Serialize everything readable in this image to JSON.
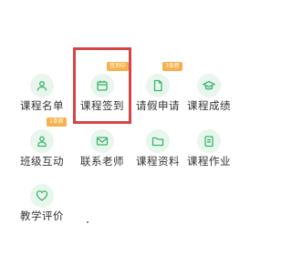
{
  "accent_color": "#3bb56b",
  "badge_color": "#f6b14c",
  "highlight_color": "#d64545",
  "tiles": [
    {
      "label": "课程名单",
      "icon": "person-list-icon",
      "badge": ""
    },
    {
      "label": "课程签到",
      "icon": "calendar-icon",
      "badge": "签到中"
    },
    {
      "label": "请假申请",
      "icon": "document-icon",
      "badge": "3条新"
    },
    {
      "label": "课程成绩",
      "icon": "graduation-cap-icon",
      "badge": ""
    },
    {
      "label": "班级互动",
      "icon": "person-icon",
      "badge": "1条新"
    },
    {
      "label": "联系老师",
      "icon": "mail-icon",
      "badge": ""
    },
    {
      "label": "课程资料",
      "icon": "folder-icon",
      "badge": ""
    },
    {
      "label": "课程作业",
      "icon": "clipboard-icon",
      "badge": ""
    },
    {
      "label": "教学评价",
      "icon": "heart-icon",
      "badge": ""
    }
  ]
}
